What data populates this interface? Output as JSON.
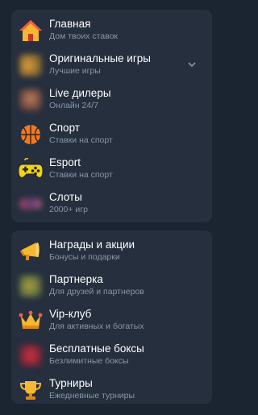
{
  "menu_main": [
    {
      "title": "Главная",
      "subtitle": "Дом твоих ставок",
      "icon": "home-icon"
    },
    {
      "title": "Оригинальные игры",
      "subtitle": "Лучшие игры",
      "icon": "original-games-icon"
    },
    {
      "title": "Live дилеры",
      "subtitle": "Онлайн 24/7",
      "icon": "live-dealers-icon"
    },
    {
      "title": "Спорт",
      "subtitle": "Ставки на спорт",
      "icon": "basketball-icon"
    },
    {
      "title": "Esport",
      "subtitle": "Ставки на спорт",
      "icon": "gamepad-icon"
    },
    {
      "title": "Слоты",
      "subtitle": "2000+ игр",
      "icon": "slots-icon"
    }
  ],
  "menu_extra": [
    {
      "title": "Награды и акции",
      "subtitle": "Бонусы и подарки",
      "icon": "megaphone-icon"
    },
    {
      "title": "Партнерка",
      "subtitle": "Для друзей и партнеров",
      "icon": "partner-icon"
    },
    {
      "title": "Vip-клуб",
      "subtitle": "Для активных и богатых",
      "icon": "crown-icon"
    },
    {
      "title": "Бесплатные боксы",
      "subtitle": "Безлимитные боксы",
      "icon": "gift-box-icon"
    },
    {
      "title": "Турниры",
      "subtitle": "Ежедневные турниры",
      "icon": "trophy-icon"
    }
  ],
  "expand_icon": "chevron-down-icon"
}
